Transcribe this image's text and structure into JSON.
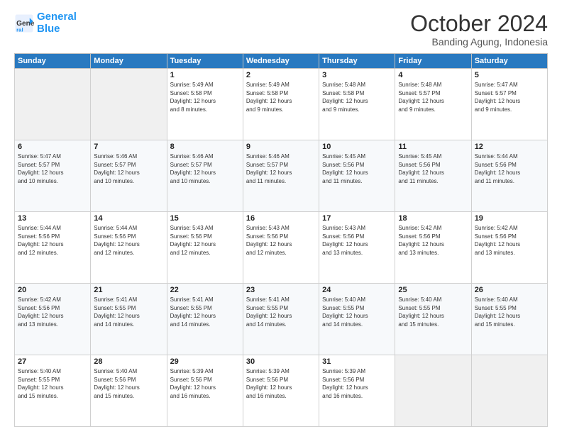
{
  "logo": {
    "line1": "General",
    "line2": "Blue"
  },
  "header": {
    "month": "October 2024",
    "location": "Banding Agung, Indonesia"
  },
  "weekdays": [
    "Sunday",
    "Monday",
    "Tuesday",
    "Wednesday",
    "Thursday",
    "Friday",
    "Saturday"
  ],
  "weeks": [
    [
      {
        "day": "",
        "info": ""
      },
      {
        "day": "",
        "info": ""
      },
      {
        "day": "1",
        "info": "Sunrise: 5:49 AM\nSunset: 5:58 PM\nDaylight: 12 hours\nand 8 minutes."
      },
      {
        "day": "2",
        "info": "Sunrise: 5:49 AM\nSunset: 5:58 PM\nDaylight: 12 hours\nand 9 minutes."
      },
      {
        "day": "3",
        "info": "Sunrise: 5:48 AM\nSunset: 5:58 PM\nDaylight: 12 hours\nand 9 minutes."
      },
      {
        "day": "4",
        "info": "Sunrise: 5:48 AM\nSunset: 5:57 PM\nDaylight: 12 hours\nand 9 minutes."
      },
      {
        "day": "5",
        "info": "Sunrise: 5:47 AM\nSunset: 5:57 PM\nDaylight: 12 hours\nand 9 minutes."
      }
    ],
    [
      {
        "day": "6",
        "info": "Sunrise: 5:47 AM\nSunset: 5:57 PM\nDaylight: 12 hours\nand 10 minutes."
      },
      {
        "day": "7",
        "info": "Sunrise: 5:46 AM\nSunset: 5:57 PM\nDaylight: 12 hours\nand 10 minutes."
      },
      {
        "day": "8",
        "info": "Sunrise: 5:46 AM\nSunset: 5:57 PM\nDaylight: 12 hours\nand 10 minutes."
      },
      {
        "day": "9",
        "info": "Sunrise: 5:46 AM\nSunset: 5:57 PM\nDaylight: 12 hours\nand 11 minutes."
      },
      {
        "day": "10",
        "info": "Sunrise: 5:45 AM\nSunset: 5:56 PM\nDaylight: 12 hours\nand 11 minutes."
      },
      {
        "day": "11",
        "info": "Sunrise: 5:45 AM\nSunset: 5:56 PM\nDaylight: 12 hours\nand 11 minutes."
      },
      {
        "day": "12",
        "info": "Sunrise: 5:44 AM\nSunset: 5:56 PM\nDaylight: 12 hours\nand 11 minutes."
      }
    ],
    [
      {
        "day": "13",
        "info": "Sunrise: 5:44 AM\nSunset: 5:56 PM\nDaylight: 12 hours\nand 12 minutes."
      },
      {
        "day": "14",
        "info": "Sunrise: 5:44 AM\nSunset: 5:56 PM\nDaylight: 12 hours\nand 12 minutes."
      },
      {
        "day": "15",
        "info": "Sunrise: 5:43 AM\nSunset: 5:56 PM\nDaylight: 12 hours\nand 12 minutes."
      },
      {
        "day": "16",
        "info": "Sunrise: 5:43 AM\nSunset: 5:56 PM\nDaylight: 12 hours\nand 12 minutes."
      },
      {
        "day": "17",
        "info": "Sunrise: 5:43 AM\nSunset: 5:56 PM\nDaylight: 12 hours\nand 13 minutes."
      },
      {
        "day": "18",
        "info": "Sunrise: 5:42 AM\nSunset: 5:56 PM\nDaylight: 12 hours\nand 13 minutes."
      },
      {
        "day": "19",
        "info": "Sunrise: 5:42 AM\nSunset: 5:56 PM\nDaylight: 12 hours\nand 13 minutes."
      }
    ],
    [
      {
        "day": "20",
        "info": "Sunrise: 5:42 AM\nSunset: 5:56 PM\nDaylight: 12 hours\nand 13 minutes."
      },
      {
        "day": "21",
        "info": "Sunrise: 5:41 AM\nSunset: 5:55 PM\nDaylight: 12 hours\nand 14 minutes."
      },
      {
        "day": "22",
        "info": "Sunrise: 5:41 AM\nSunset: 5:55 PM\nDaylight: 12 hours\nand 14 minutes."
      },
      {
        "day": "23",
        "info": "Sunrise: 5:41 AM\nSunset: 5:55 PM\nDaylight: 12 hours\nand 14 minutes."
      },
      {
        "day": "24",
        "info": "Sunrise: 5:40 AM\nSunset: 5:55 PM\nDaylight: 12 hours\nand 14 minutes."
      },
      {
        "day": "25",
        "info": "Sunrise: 5:40 AM\nSunset: 5:55 PM\nDaylight: 12 hours\nand 15 minutes."
      },
      {
        "day": "26",
        "info": "Sunrise: 5:40 AM\nSunset: 5:55 PM\nDaylight: 12 hours\nand 15 minutes."
      }
    ],
    [
      {
        "day": "27",
        "info": "Sunrise: 5:40 AM\nSunset: 5:55 PM\nDaylight: 12 hours\nand 15 minutes."
      },
      {
        "day": "28",
        "info": "Sunrise: 5:40 AM\nSunset: 5:56 PM\nDaylight: 12 hours\nand 15 minutes."
      },
      {
        "day": "29",
        "info": "Sunrise: 5:39 AM\nSunset: 5:56 PM\nDaylight: 12 hours\nand 16 minutes."
      },
      {
        "day": "30",
        "info": "Sunrise: 5:39 AM\nSunset: 5:56 PM\nDaylight: 12 hours\nand 16 minutes."
      },
      {
        "day": "31",
        "info": "Sunrise: 5:39 AM\nSunset: 5:56 PM\nDaylight: 12 hours\nand 16 minutes."
      },
      {
        "day": "",
        "info": ""
      },
      {
        "day": "",
        "info": ""
      }
    ]
  ]
}
